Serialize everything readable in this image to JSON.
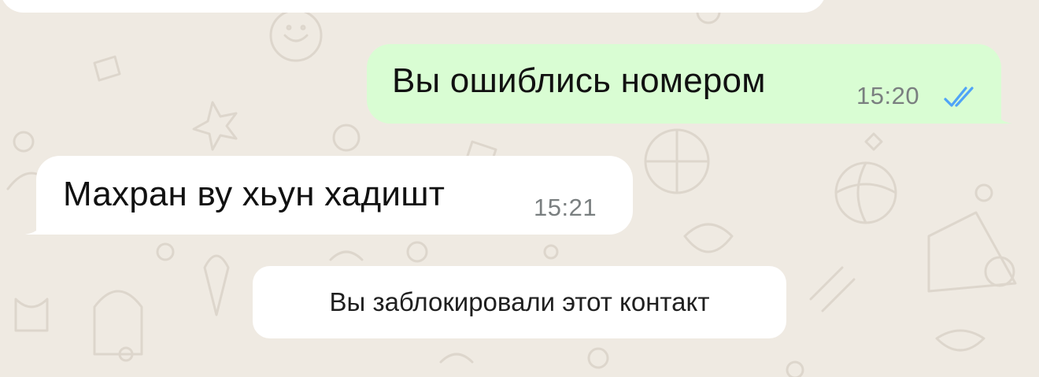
{
  "chat": {
    "messages": [
      {
        "direction": "outgoing",
        "text": "Вы ошиблись номером",
        "time": "15:20",
        "status_icon": "double-check-read-icon"
      },
      {
        "direction": "incoming",
        "text": "Махран ву хьун хадишт",
        "time": "15:21"
      }
    ],
    "system_notice": "Вы заблокировали этот контакт"
  },
  "colors": {
    "background": "#efeae2",
    "outgoing_bubble": "#d9fdd3",
    "incoming_bubble": "#ffffff",
    "read_ticks": "#4fa3f7",
    "timestamp": "#7a7f80"
  }
}
